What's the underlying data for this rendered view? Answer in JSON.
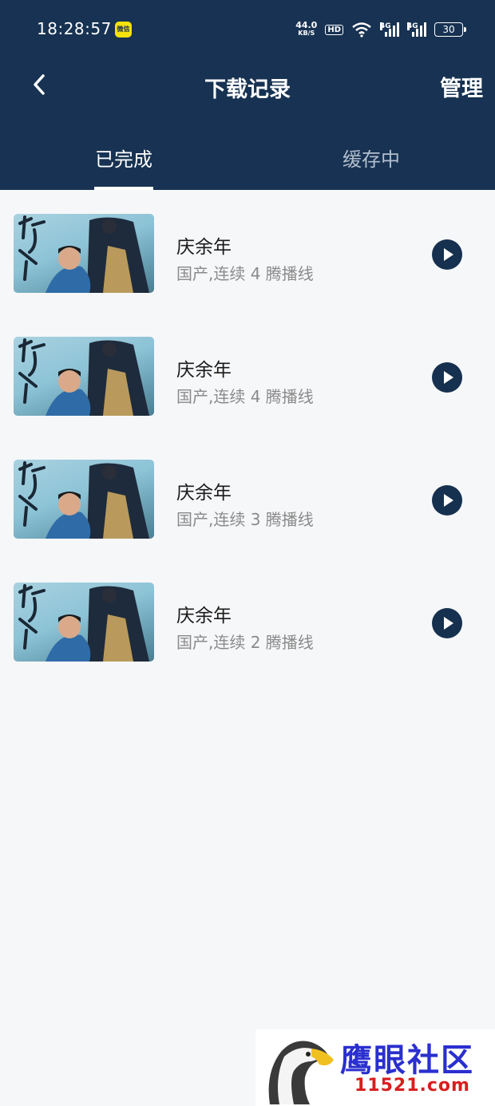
{
  "status_bar": {
    "time": "18:28:57",
    "app_badge": "微信",
    "speed_value": "44.0",
    "speed_unit": "KB/S",
    "hd_badge": "HD",
    "signal_1_label": "4G",
    "signal_2_label": "4G",
    "battery": "30"
  },
  "nav": {
    "title": "下载记录",
    "manage_label": "管理"
  },
  "tabs": [
    {
      "label": "已完成",
      "active": true
    },
    {
      "label": "缓存中",
      "active": false
    }
  ],
  "downloads": [
    {
      "title": "庆余年",
      "subtitle": "国产,连续 4 腾播线"
    },
    {
      "title": "庆余年",
      "subtitle": "国产,连续 4 腾播线"
    },
    {
      "title": "庆余年",
      "subtitle": "国产,连续 3 腾播线"
    },
    {
      "title": "庆余年",
      "subtitle": "国产,连续 2 腾播线"
    }
  ],
  "watermark": {
    "text": "鹰眼社区",
    "url": "11521.com"
  },
  "colors": {
    "header_bg": "#173252",
    "page_bg": "#f6f7f9",
    "play_button": "#16304f",
    "inactive_tab": "#b3bfcd"
  },
  "icons": [
    "back-arrow-icon",
    "play-icon",
    "wifi-icon",
    "signal-icon",
    "battery-icon",
    "eagle-logo"
  ]
}
